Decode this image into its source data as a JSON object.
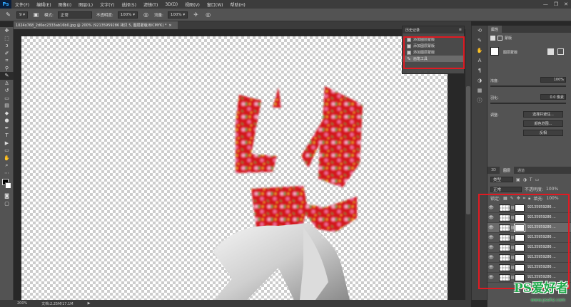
{
  "menubar": {
    "logo": "Ps",
    "items": [
      "文件(F)",
      "编辑(E)",
      "图像(I)",
      "图层(L)",
      "文字(Y)",
      "选择(S)",
      "滤镜(T)",
      "3D(D)",
      "视图(V)",
      "窗口(W)",
      "帮助(H)"
    ],
    "controls": [
      "—",
      "❐",
      "✕"
    ]
  },
  "options": {
    "brush_size": "9",
    "mode_label": "模式:",
    "mode_value": "正常",
    "opacity_label": "不透明度:",
    "opacity_value": "100%",
    "flow_label": "流量:",
    "flow_value": "100%"
  },
  "document": {
    "tab_title": "1024x768_2d0ec2333ab16b0.jpg @ 200% (92135959286 拷贝 5, 图层蒙版/8/CMYK) *"
  },
  "status": {
    "zoom": "200%",
    "doc_size": "文档:2.25M/17.1M"
  },
  "history": {
    "title": "历史记录",
    "items": [
      {
        "label": "添加图层蒙版"
      },
      {
        "label": "添加图层蒙版"
      },
      {
        "label": "添加图层蒙版"
      },
      {
        "label": "画笔工具"
      }
    ]
  },
  "properties": {
    "tab": "属性",
    "mask_kind": "蒙版",
    "mask_title": "图层蒙版",
    "density_label": "浓度:",
    "density_value": "100%",
    "feather_label": "羽化:",
    "feather_value": "0.0 像素",
    "adjust_label": "调整:",
    "btn_select_mask": "选择并遮住...",
    "btn_color_range": "颜色范围...",
    "btn_invert": "反相"
  },
  "layers": {
    "tabs": [
      "3D",
      "图层",
      "通道"
    ],
    "filter_label": "类型",
    "blend_mode": "正常",
    "opacity_label": "不透明度:",
    "opacity_value": "100%",
    "lock_label": "锁定:",
    "fill_label": "填充:",
    "fill_value": "100%",
    "rows": [
      {
        "name": "92135959286 ..."
      },
      {
        "name": "92135959286 ..."
      },
      {
        "name": "92135959286 ..."
      },
      {
        "name": "92135959286 ..."
      },
      {
        "name": "92135959286 ..."
      },
      {
        "name": "92135959286 ..."
      },
      {
        "name": "92135959286 ..."
      },
      {
        "name": "92135959286 ..."
      }
    ]
  },
  "watermark": {
    "text": "PS爱好者",
    "url": "www.psahz.com"
  },
  "colors": {
    "highlight": "#e01a22",
    "fabric_red": "#d4141e",
    "watermark_green": "#1fa84a"
  }
}
